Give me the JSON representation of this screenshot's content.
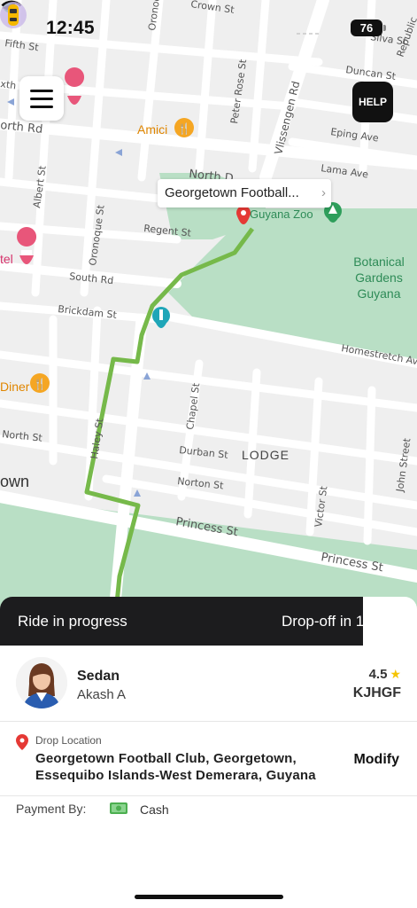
{
  "status_bar": {
    "time": "12:45",
    "battery": "76"
  },
  "map": {
    "help_label": "HELP",
    "destination_callout": "Georgetown Football...",
    "area_labels": [
      "LODGE",
      "own"
    ],
    "poi": {
      "amici": "Amici",
      "guyana_zoo": "Guyana Zoo",
      "botanical": [
        "Botanical",
        "Gardens",
        "Guyana"
      ],
      "diner": "Diner",
      "hotel": "tel"
    },
    "streets": {
      "crown": "Crown St",
      "fifth": "Fifth St",
      "sixth": "xth St",
      "north_rd": "orth Rd",
      "north_d": "North D",
      "regent": "Regent St",
      "south_rd": "South Rd",
      "brickdam": "Brickdam St",
      "north_st": "North St",
      "haley": "Haley St",
      "durban": "Durban St",
      "norton": "Norton St",
      "princess_left": "Princess St",
      "princess_right": "Princess St",
      "homestretch": "Homestretch Ave",
      "chapel": "Chapel St",
      "victor": "Victor St",
      "john": "John Street",
      "albert": "Albert St",
      "oronoque": "Oronoque St",
      "oronoq_top": "Oronoq",
      "peter_rose": "Peter Rose St",
      "vlissengen": "Vlissengen Rd",
      "duncan": "Duncan St",
      "eping": "Eping Ave",
      "lama": "Lama Ave",
      "silva": "Silva St",
      "republic": "Republic"
    }
  },
  "ride": {
    "status": "Ride in progress",
    "eta": "Drop-off in 1"
  },
  "driver": {
    "car_type": "Sedan",
    "name": "Akash A",
    "rating": "4.5",
    "plate": "KJHGF"
  },
  "drop": {
    "label": "Drop Location",
    "address": "Georgetown Football Club, Georgetown, Essequibo Islands-West Demerara, Guyana",
    "modify_label": "Modify"
  },
  "payment": {
    "label": "Payment By:",
    "method": "Cash"
  },
  "colors": {
    "route": "#76b94a",
    "park": "#b9dfc5",
    "banner": "#1c1c1e",
    "pin": "#e53935",
    "star": "#f5c400"
  }
}
